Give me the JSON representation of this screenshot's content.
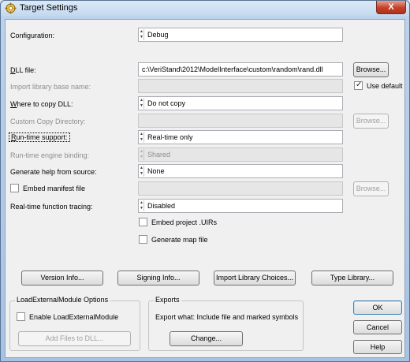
{
  "window": {
    "title": "Target Settings",
    "close_glyph": "X"
  },
  "form": {
    "configuration": {
      "label": "Configuration:",
      "value": "Debug"
    },
    "dll_file": {
      "label": "DLL file:",
      "value": "c:\\VeriStand\\2012\\ModelInterface\\custom\\random\\rand.dll",
      "browse": "Browse..."
    },
    "import_library": {
      "label": "Import library base name:",
      "value": "",
      "use_default": "Use default",
      "use_default_checked": true
    },
    "where_to_copy": {
      "label": "Where to copy DLL:",
      "value": "Do not copy"
    },
    "custom_copy_dir": {
      "label": "Custom Copy Directory:",
      "value": "",
      "browse": "Browse..."
    },
    "runtime_support": {
      "label": "Run-time support:",
      "value": "Real-time only"
    },
    "runtime_binding": {
      "label": "Run-time engine binding:",
      "value": "Shared"
    },
    "generate_help": {
      "label": "Generate help from source:",
      "value": "None"
    },
    "embed_manifest": {
      "label": "Embed manifest file",
      "checked": false,
      "value": "",
      "browse": "Browse..."
    },
    "rt_tracing": {
      "label": "Real-time function tracing:",
      "value": "Disabled"
    },
    "embed_uirs": {
      "label": "Embed project .UIRs",
      "checked": false
    },
    "gen_map": {
      "label": "Generate map file",
      "checked": false
    }
  },
  "buttons": {
    "version_info": "Version Info...",
    "signing_info": "Signing Info...",
    "import_choices": "Import Library Choices...",
    "type_library": "Type Library...",
    "ok": "OK",
    "cancel": "Cancel",
    "help": "Help"
  },
  "load_external": {
    "title": "LoadExternalModule Options",
    "enable_label": "Enable LoadExternalModule",
    "enable_checked": false,
    "add_files": "Add Files to DLL..."
  },
  "exports": {
    "title": "Exports",
    "text": "Export what:  Include file and marked symbols",
    "change": "Change..."
  },
  "icons": {
    "app": "gear-icon",
    "ring_arrows": "up-down-arrows-icon",
    "check": "checkmark-icon"
  }
}
